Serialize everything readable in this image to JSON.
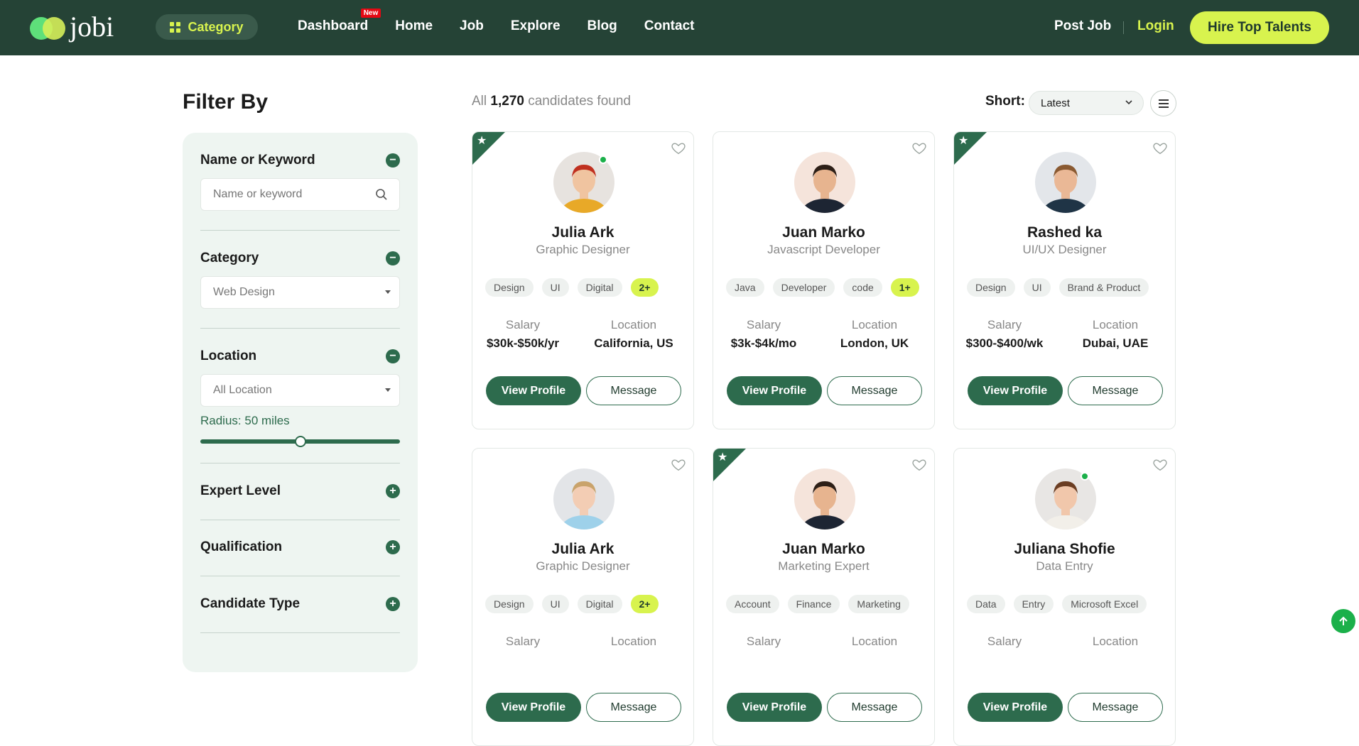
{
  "header": {
    "logo_text": "jobi",
    "category_label": "Category",
    "nav": [
      {
        "label": "Dashboard",
        "badge": "New"
      },
      {
        "label": "Home"
      },
      {
        "label": "Job"
      },
      {
        "label": "Explore"
      },
      {
        "label": "Blog"
      },
      {
        "label": "Contact"
      }
    ],
    "post_job": "Post Job",
    "login": "Login",
    "hire_button": "Hire Top Talents"
  },
  "filter": {
    "title": "Filter By",
    "name_keyword": {
      "title": "Name or Keyword",
      "placeholder": "Name or keyword",
      "toggle": "−"
    },
    "category": {
      "title": "Category",
      "value": "Web Design",
      "toggle": "−"
    },
    "location": {
      "title": "Location",
      "value": "All Location",
      "toggle": "−",
      "radius_label": "Radius:",
      "radius_value": "50 miles",
      "radius_fraction": 0.5
    },
    "expert_level": {
      "title": "Expert Level",
      "toggle": "+"
    },
    "qualification": {
      "title": "Qualification",
      "toggle": "+"
    },
    "candidate_type": {
      "title": "Candidate Type",
      "toggle": "+"
    }
  },
  "results": {
    "prefix": "All",
    "count": "1,270",
    "suffix": "candidates found",
    "sort_label": "Short:",
    "sort_value": "Latest"
  },
  "labels": {
    "salary": "Salary",
    "location": "Location",
    "view_profile": "View Profile",
    "message": "Message"
  },
  "candidates": [
    {
      "name": "Julia Ark",
      "role": "Graphic Designer",
      "tags": [
        "Design",
        "UI",
        "Digital"
      ],
      "more": "2+",
      "salary": "$30k-$50k/yr",
      "location": "California, US",
      "featured": true,
      "online": true,
      "skin": "#f0c4a0",
      "hair": "#c0301f",
      "shirt": "#e8a928",
      "bg": "#e7e3df"
    },
    {
      "name": "Juan Marko",
      "role": "Javascript Developer",
      "tags": [
        "Java",
        "Developer",
        "code"
      ],
      "more": "1+",
      "salary": "$3k-$4k/mo",
      "location": "London, UK",
      "featured": false,
      "online": false,
      "skin": "#e7b48f",
      "hair": "#2d1f17",
      "shirt": "#1d2533",
      "bg": "#f5e4db"
    },
    {
      "name": "Rashed ka",
      "role": "UI/UX Designer",
      "tags": [
        "Design",
        "UI",
        "Brand & Product"
      ],
      "more": "",
      "salary": "$300-$400/wk",
      "location": "Dubai, UAE",
      "featured": true,
      "online": false,
      "skin": "#eab896",
      "hair": "#8a5a32",
      "shirt": "#1f3446",
      "bg": "#e3e6ea"
    },
    {
      "name": "Julia Ark",
      "role": "Graphic Designer",
      "tags": [
        "Design",
        "UI",
        "Digital"
      ],
      "more": "2+",
      "featured": false,
      "online": false,
      "skin": "#f3cdb4",
      "hair": "#c9a36b",
      "shirt": "#9ed1ea",
      "bg": "#e3e5e8"
    },
    {
      "name": "Juan Marko",
      "role": "Marketing Expert",
      "tags": [
        "Account",
        "Finance",
        "Marketing"
      ],
      "more": "",
      "featured": true,
      "online": false,
      "skin": "#e7b48f",
      "hair": "#2d1f17",
      "shirt": "#1d2533",
      "bg": "#f5e4db"
    },
    {
      "name": "Juliana Shofie",
      "role": "Data Entry",
      "tags": [
        "Data",
        "Entry",
        "Microsoft Excel"
      ],
      "more": "",
      "featured": false,
      "online": true,
      "skin": "#f1c7ab",
      "hair": "#6b3e23",
      "shirt": "#f2efe9",
      "bg": "#e8e6e4"
    }
  ],
  "colors": {
    "header_bg": "#254336",
    "accent": "#d8f34e",
    "primary": "#2d6b4d",
    "sidebar_bg": "#eef5f1"
  }
}
